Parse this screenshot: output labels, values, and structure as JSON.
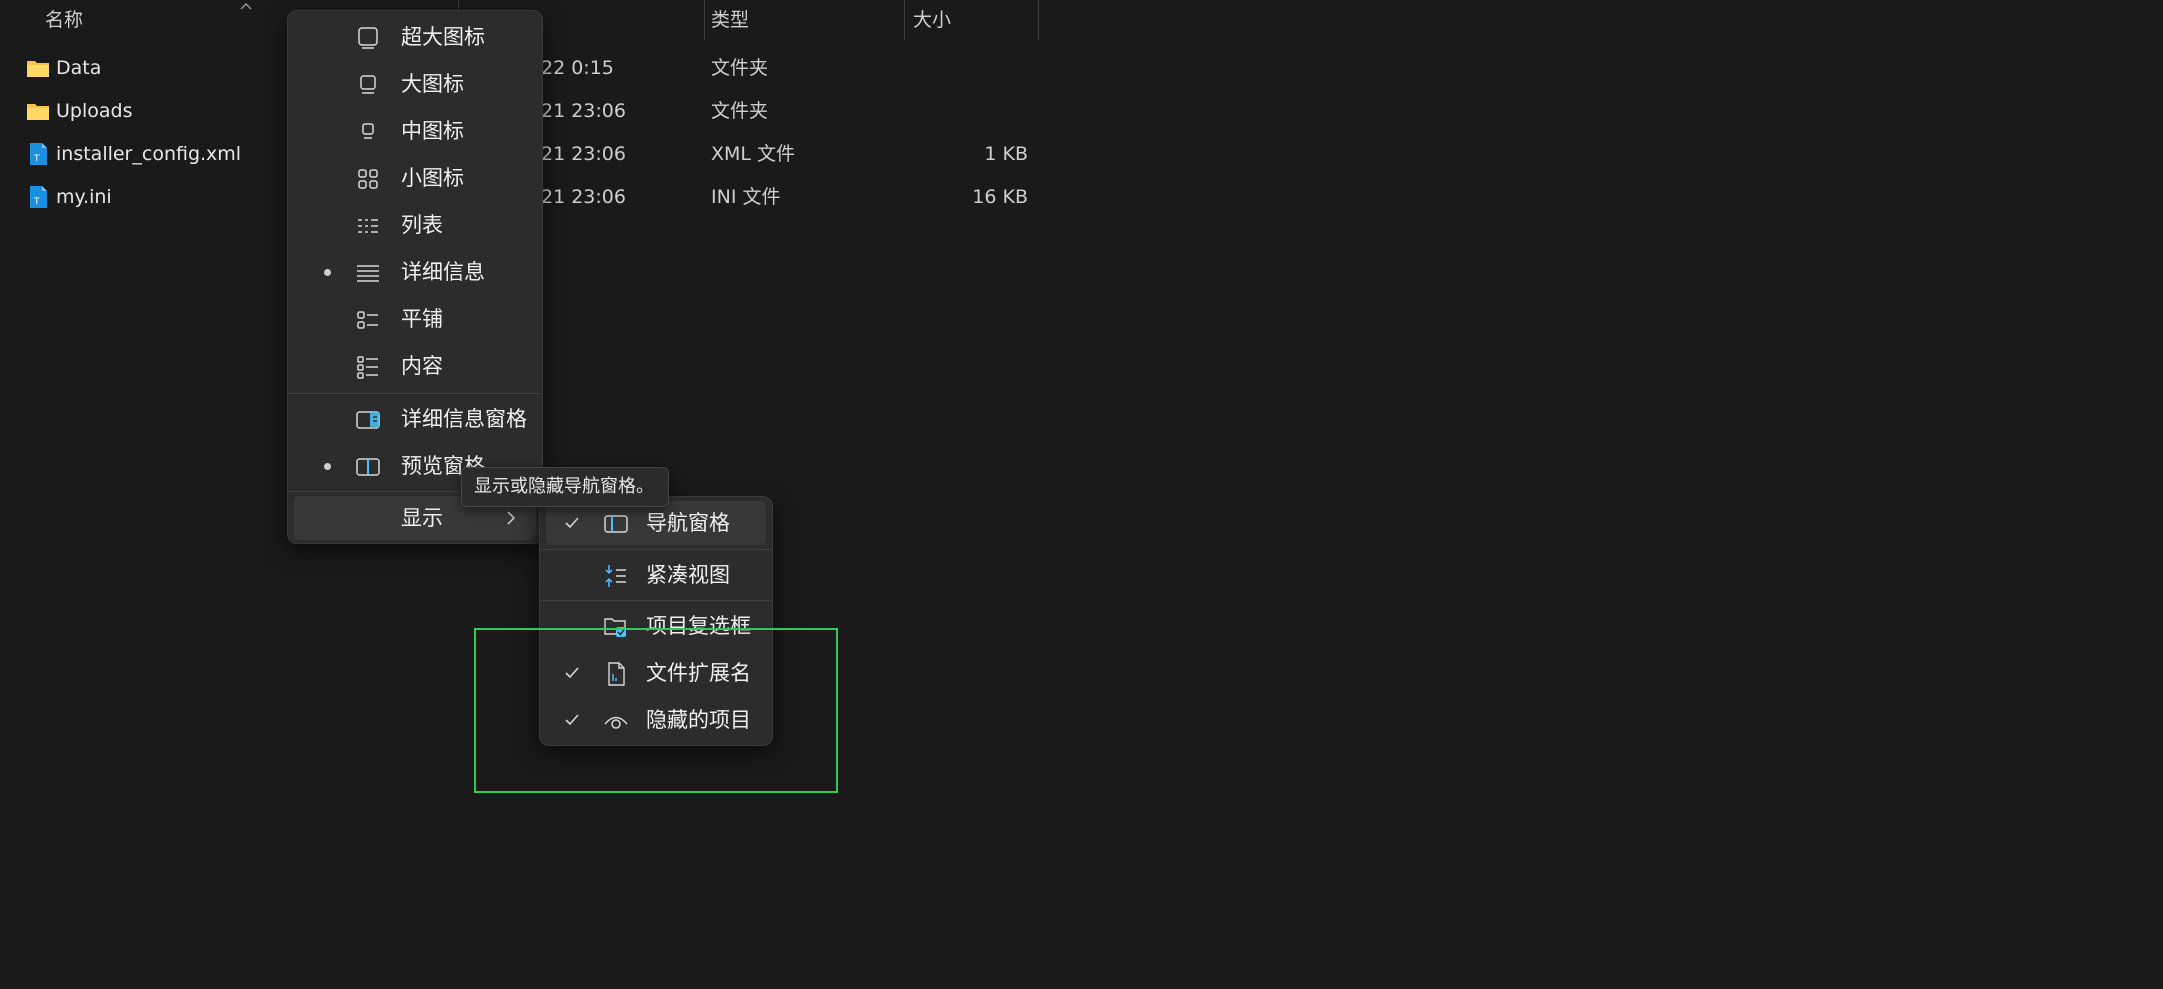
{
  "columns": {
    "name": "名称",
    "type": "类型",
    "size": "大小"
  },
  "files": [
    {
      "name": "Data",
      "icon": "folder-icon",
      "date": "22 0:15",
      "type": "文件夹",
      "size": ""
    },
    {
      "name": "Uploads",
      "icon": "folder-icon",
      "date": "21 23:06",
      "type": "文件夹",
      "size": ""
    },
    {
      "name": "installer_config.xml",
      "icon": "text-file-icon",
      "date": "21 23:06",
      "type": "XML 文件",
      "size": "1 KB"
    },
    {
      "name": "my.ini",
      "icon": "text-file-icon",
      "date": "21 23:06",
      "type": "INI 文件",
      "size": "16 KB"
    }
  ],
  "view_menu": {
    "items": [
      {
        "label": "超大图标",
        "icon": "extra-large-icons-icon",
        "selected": false
      },
      {
        "label": "大图标",
        "icon": "large-icons-icon",
        "selected": false
      },
      {
        "label": "中图标",
        "icon": "medium-icons-icon",
        "selected": false
      },
      {
        "label": "小图标",
        "icon": "small-icons-icon",
        "selected": false
      },
      {
        "label": "列表",
        "icon": "list-icon",
        "selected": false
      },
      {
        "label": "详细信息",
        "icon": "details-icon",
        "selected": true
      },
      {
        "label": "平铺",
        "icon": "tiles-icon",
        "selected": false
      },
      {
        "label": "内容",
        "icon": "content-icon",
        "selected": false
      },
      {
        "label": "详细信息窗格",
        "icon": "details-pane-icon",
        "selected": false
      },
      {
        "label": "预览窗格",
        "icon": "preview-pane-icon",
        "selected": true
      },
      {
        "label": "显示",
        "icon": "",
        "selected": false
      }
    ]
  },
  "tooltip": "显示或隐藏导航窗格。",
  "show_menu": {
    "items": [
      {
        "label": "导航窗格",
        "icon": "navigation-pane-icon",
        "checked": true
      },
      {
        "label": "紧凑视图",
        "icon": "compact-view-icon",
        "checked": false
      },
      {
        "label": "项目复选框",
        "icon": "item-checkbox-icon",
        "checked": false
      },
      {
        "label": "文件扩展名",
        "icon": "file-extension-icon",
        "checked": true
      },
      {
        "label": "隐藏的项目",
        "icon": "hidden-items-icon",
        "checked": true
      }
    ]
  },
  "colors": {
    "background": "#1a1a1a",
    "menu": "#2c2c2c",
    "accent": "#4cc2ff",
    "folder": "#f8c444",
    "selection": "#2ecc55"
  }
}
